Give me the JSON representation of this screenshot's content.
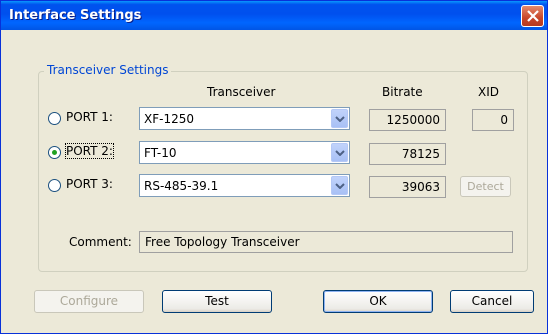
{
  "window": {
    "title": "Interface Settings"
  },
  "group": {
    "label": "Transceiver Settings",
    "headers": {
      "transceiver": "Transceiver",
      "bitrate": "Bitrate",
      "xid": "XID"
    }
  },
  "ports": [
    {
      "label": "PORT 1:",
      "selected": false,
      "transceiver": "XF-1250",
      "bitrate": "1250000",
      "xid": "0"
    },
    {
      "label": "PORT 2:",
      "selected": true,
      "transceiver": "FT-10",
      "bitrate": "78125"
    },
    {
      "label": "PORT 3:",
      "selected": false,
      "transceiver": "RS-485-39.1",
      "bitrate": "39063",
      "detect_label": "Detect"
    }
  ],
  "comment": {
    "label": "Comment:",
    "value": "Free Topology Transceiver"
  },
  "buttons": {
    "configure": "Configure",
    "test": "Test",
    "ok": "OK",
    "cancel": "Cancel"
  },
  "colors": {
    "title_bar": "#0054e3",
    "group_label": "#0046d5",
    "dialog_bg": "#ece9d8",
    "radio_dot": "#21a121"
  }
}
